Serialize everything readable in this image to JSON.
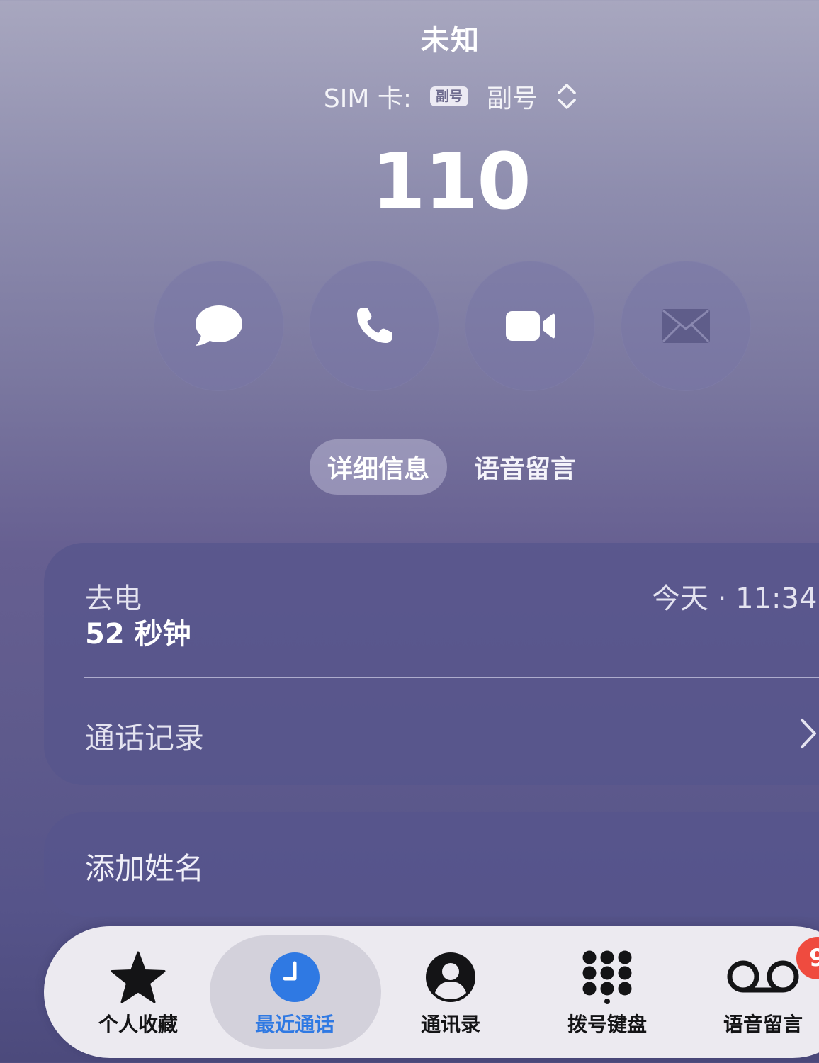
{
  "header": {
    "contact_name": "未知",
    "sim_label": "SIM 卡:",
    "sim_chip": "副号",
    "sim_name": "副号",
    "phone_number": "110"
  },
  "actions": [
    {
      "name": "message",
      "icon": "message-bubble-icon",
      "enabled": true
    },
    {
      "name": "call",
      "icon": "phone-icon",
      "enabled": true
    },
    {
      "name": "video",
      "icon": "video-camera-icon",
      "enabled": true
    },
    {
      "name": "mail",
      "icon": "envelope-icon",
      "enabled": false
    }
  ],
  "tabs": {
    "details": "详细信息",
    "voicemail": "语音留言",
    "active": "details"
  },
  "call_card": {
    "type": "去电",
    "duration": "52 秒钟",
    "time": "今天 · 11:34",
    "history_label": "通话记录"
  },
  "name_card": {
    "label": "添加姓名"
  },
  "tabbar": {
    "items": [
      {
        "label": "个人收藏",
        "icon": "star-icon"
      },
      {
        "label": "最近通话",
        "icon": "clock-icon",
        "active": true
      },
      {
        "label": "通讯录",
        "icon": "person-circle-icon"
      },
      {
        "label": "拨号键盘",
        "icon": "keypad-icon"
      },
      {
        "label": "语音留言",
        "icon": "voicemail-icon"
      }
    ],
    "voicemail_badge": "9"
  },
  "colors": {
    "accent_blue": "#2f79e3",
    "badge_red": "#ef4b3f",
    "tabbar_bg": "#eceaf0"
  }
}
